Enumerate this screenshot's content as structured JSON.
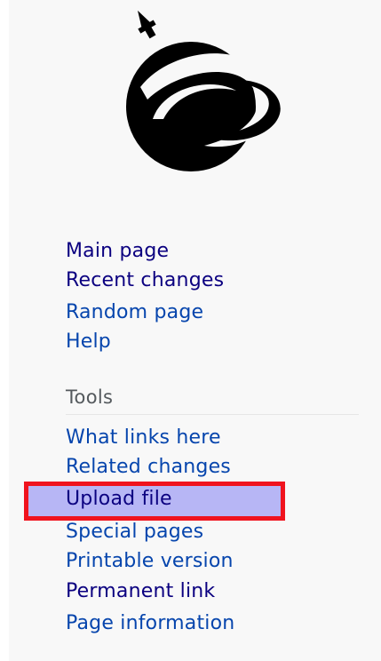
{
  "navigation": {
    "items": [
      {
        "label": "Main page"
      },
      {
        "label": "Recent changes"
      },
      {
        "label": "Random page"
      },
      {
        "label": "Help"
      }
    ]
  },
  "tools": {
    "heading": "Tools",
    "items": [
      {
        "label": "What links here"
      },
      {
        "label": "Related changes"
      },
      {
        "label": "Upload file",
        "highlighted": true
      },
      {
        "label": "Special pages"
      },
      {
        "label": "Printable version"
      },
      {
        "label": "Permanent link"
      },
      {
        "label": "Page information"
      }
    ]
  },
  "colors": {
    "link": "#0645ad",
    "visited_link": "#0b0080",
    "highlight_border": "#f0131e",
    "highlight_fill": "#b7b6f5",
    "panel_background": "#f8f8f8"
  },
  "logo": {
    "icon": "planet-logo-icon"
  }
}
